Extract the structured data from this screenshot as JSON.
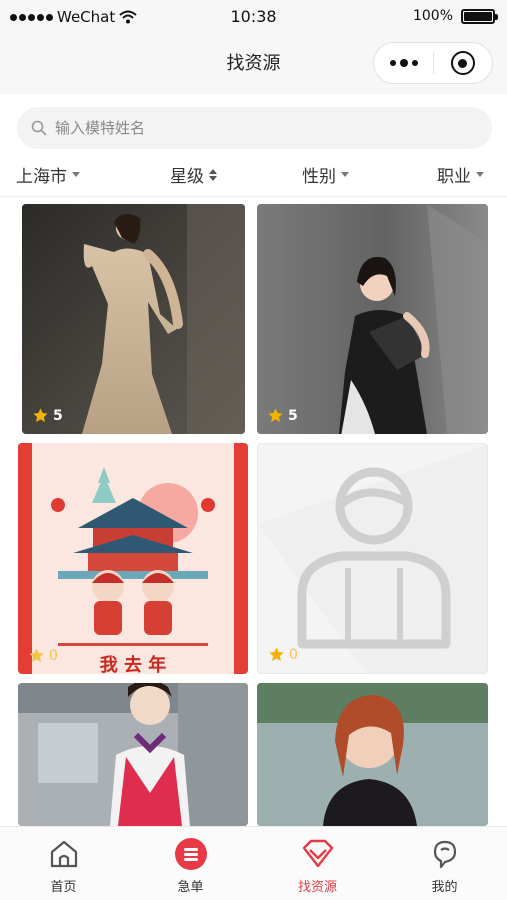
{
  "status_bar": {
    "carrier": "WeChat",
    "time": "10:38",
    "battery": "100%",
    "battery_level": 1.0
  },
  "nav": {
    "title": "找资源"
  },
  "search": {
    "placeholder": "输入模特姓名"
  },
  "filters": [
    {
      "label": "上海市",
      "icon": "caret-down-icon"
    },
    {
      "label": "星级",
      "icon": "sort-icon"
    },
    {
      "label": "性别",
      "icon": "caret-down-icon"
    },
    {
      "label": "职业",
      "icon": "caret-down-icon"
    }
  ],
  "cards": [
    {
      "rating": "5",
      "image": "woman-in-champagne-gown-photo"
    },
    {
      "rating": "5",
      "image": "woman-in-black-dress-photo"
    },
    {
      "rating": "0",
      "image": "new-year-poster-image",
      "poster_text": "我 去 年"
    },
    {
      "rating": "0",
      "image": "default-avatar-placeholder"
    },
    {
      "rating": "",
      "image": "woman-in-red-uniform-photo"
    },
    {
      "rating": "",
      "image": "woman-lakeside-photo"
    }
  ],
  "tabs": [
    {
      "label": "首页",
      "icon": "home-icon"
    },
    {
      "label": "急单",
      "icon": "urgent-order-icon"
    },
    {
      "label": "找资源",
      "icon": "diamond-icon"
    },
    {
      "label": "我的",
      "icon": "profile-icon"
    }
  ],
  "colors": {
    "accent": "#e83a45",
    "star": "#f5b301",
    "star_inactive": "#f6c445"
  }
}
